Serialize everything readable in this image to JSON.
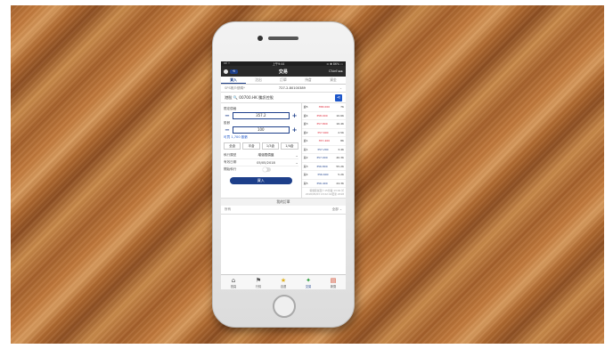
{
  "status": {
    "carrier": "ıııl ⌔",
    "time": "上午9:44",
    "battery": "⊙ ✱ 86% ▭"
  },
  "header": {
    "title": "交易",
    "logo": "Chief ▸▸▸"
  },
  "tabs": [
    {
      "label": "買入"
    },
    {
      "label": "沽出"
    },
    {
      "label": "訂單"
    },
    {
      "label": "持倉"
    },
    {
      "label": "資金"
    }
  ],
  "account": {
    "label": "SPS帳戶號碼*",
    "value": "727-2-80100389"
  },
  "stock": {
    "market": "港股",
    "code_name": "00700.HK 騰訊控股"
  },
  "order": {
    "price_label": "限定價格",
    "price": "357.2",
    "qty_label": "股數",
    "qty": "100",
    "buyable": "可買 1,700 股數",
    "qty_buttons": [
      "全倉",
      "半倉",
      "1/3倉",
      "1/4倉"
    ],
    "order_type_label": "執行類型",
    "order_type": "增強限價盤",
    "date_label": "有效日期",
    "date": "05/05/2018",
    "toggle_label": "開始執行",
    "buy_label": "買入"
  },
  "bids": [
    {
      "side": "賣5",
      "price": "358.000",
      "qty": "7K"
    },
    {
      "side": "賣4",
      "price": "358.000",
      "qty": "10.6K"
    },
    {
      "side": "賣3",
      "price": "357.800",
      "qty": "16.4K"
    },
    {
      "side": "賣2",
      "price": "357.600",
      "qty": "2.5K"
    },
    {
      "side": "賣1",
      "price": "357.400",
      "qty": "8K"
    },
    {
      "side": "買1",
      "price": "357.200",
      "qty": "3.4K"
    },
    {
      "side": "買2",
      "price": "357.000",
      "qty": "40.3K"
    },
    {
      "side": "買3",
      "price": "356.800",
      "qty": "55.2K"
    },
    {
      "side": "買4",
      "price": "356.600",
      "qty": "5.2K"
    },
    {
      "side": "買5",
      "price": "356.400",
      "qty": "24.3K"
    }
  ],
  "quote_note": "報價延遲至少15分鐘 13:02 於2018/05/03 13:02:41更新 2018",
  "my_orders": "我的訂單",
  "filter": {
    "label": "所有",
    "value": "全部"
  },
  "nav": [
    {
      "label": "首頁",
      "icon": "home-icon",
      "glyph": "⌂"
    },
    {
      "label": "行情",
      "icon": "market-icon",
      "glyph": "⚑"
    },
    {
      "label": "自選",
      "icon": "star-icon",
      "glyph": "★"
    },
    {
      "label": "交易",
      "icon": "trade-icon",
      "glyph": "✦"
    },
    {
      "label": "新聞",
      "icon": "news-icon",
      "glyph": "▤"
    }
  ]
}
